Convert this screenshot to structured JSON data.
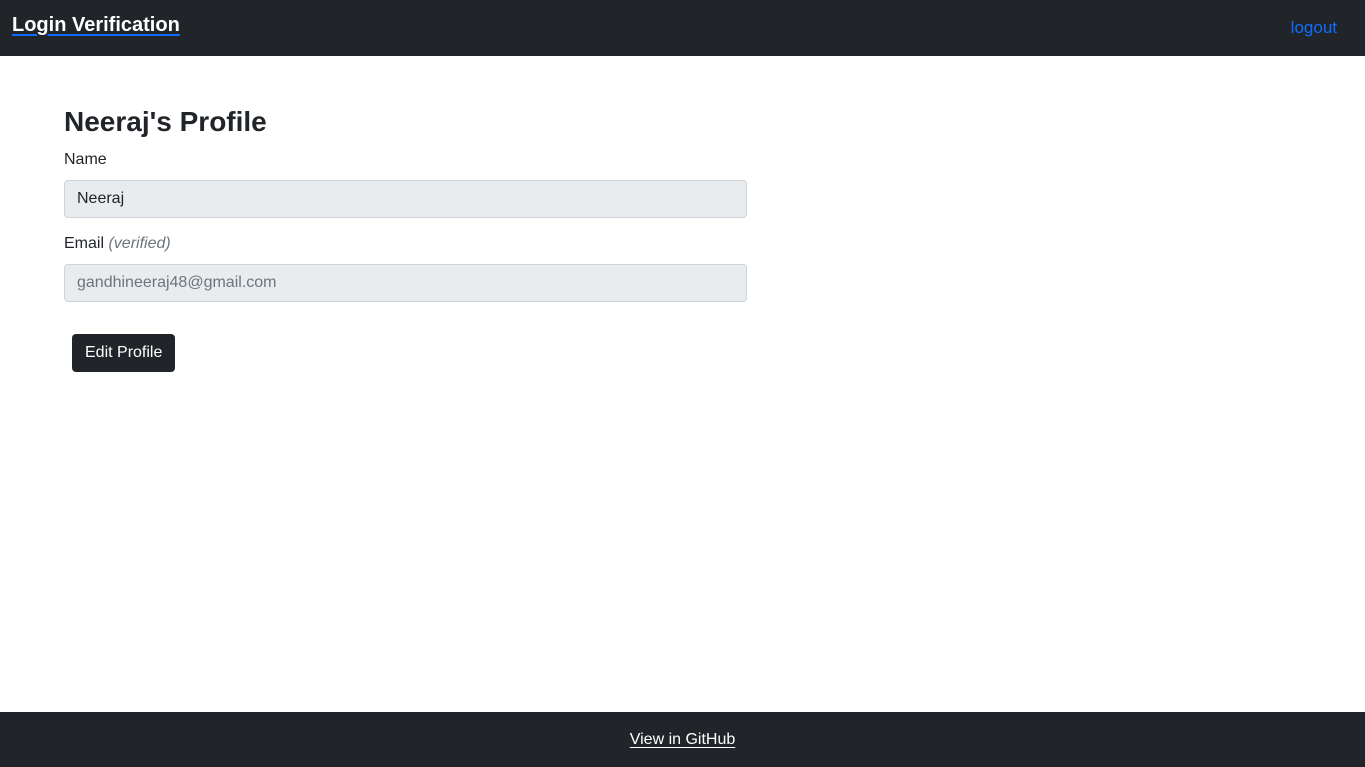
{
  "navbar": {
    "brand": "Login Verification",
    "logout_label": "logout"
  },
  "profile": {
    "title": "Neeraj's Profile",
    "name_label": "Name",
    "name_value": "Neeraj",
    "email_label": "Email",
    "email_note": "(verified)",
    "email_value": "gandhineeraj48@gmail.com",
    "edit_button_label": "Edit Profile"
  },
  "footer": {
    "github_link": "View in GitHub"
  },
  "colors": {
    "navbar_bg": "#212529",
    "link_blue": "#0d6efd",
    "input_bg": "#e9ecef",
    "button_bg": "#212529"
  }
}
